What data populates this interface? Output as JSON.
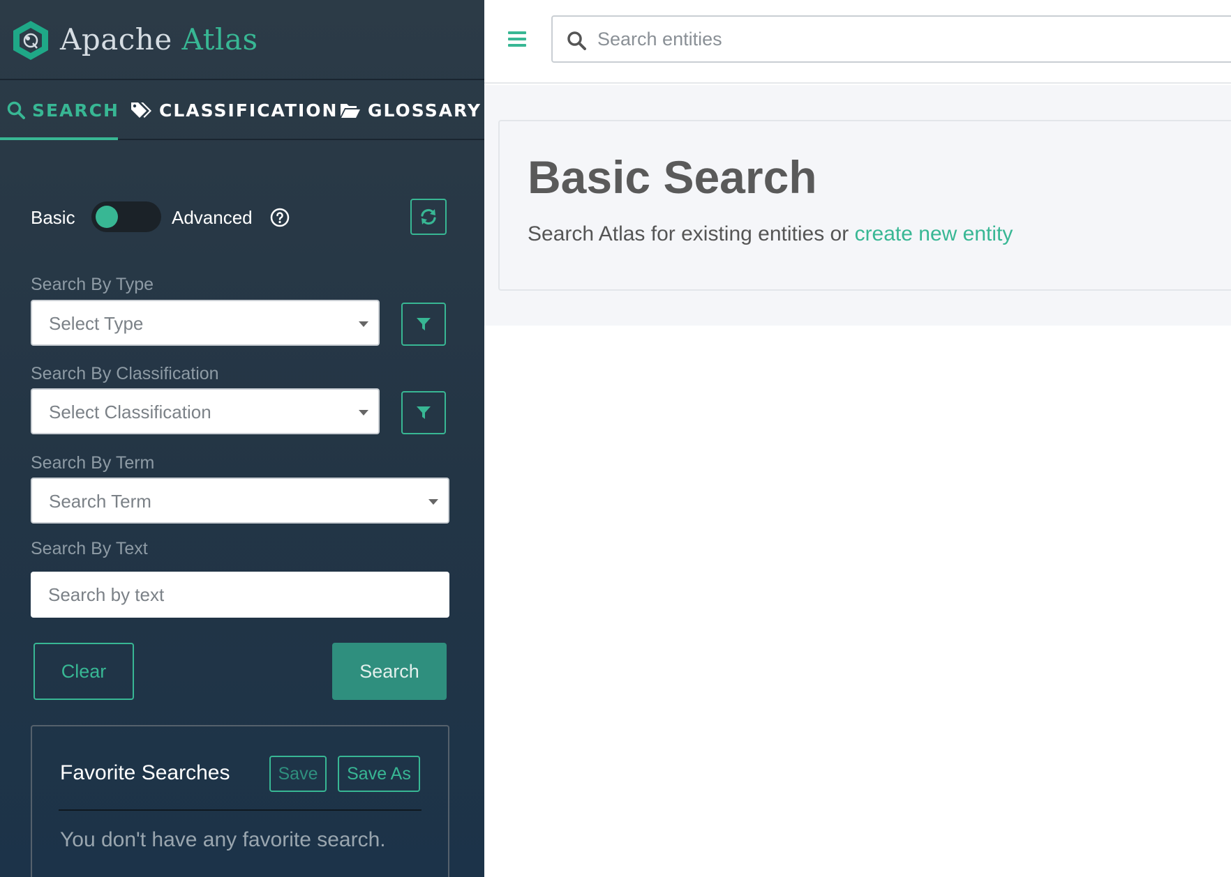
{
  "brand": {
    "name_part1": "Apache",
    "name_part2": "Atlas"
  },
  "tabs": [
    {
      "label": "SEARCH",
      "icon": "search-icon",
      "active": true
    },
    {
      "label": "CLASSIFICATION",
      "icon": "tags-icon",
      "active": false
    },
    {
      "label": "GLOSSARY",
      "icon": "folder-open-icon",
      "active": false
    }
  ],
  "mode_toggle": {
    "basic_label": "Basic",
    "advanced_label": "Advanced",
    "state": "basic"
  },
  "filters": {
    "type": {
      "label": "Search By Type",
      "placeholder": "Select Type"
    },
    "classification": {
      "label": "Search By Classification",
      "placeholder": "Select Classification"
    },
    "term": {
      "label": "Search By Term",
      "placeholder": "Search Term"
    },
    "text": {
      "label": "Search By Text",
      "placeholder": "Search by text"
    }
  },
  "actions": {
    "clear_label": "Clear",
    "search_label": "Search"
  },
  "favorites": {
    "title": "Favorite Searches",
    "save_label": "Save",
    "save_as_label": "Save As",
    "empty_text": "You don't have any favorite search."
  },
  "global_search": {
    "placeholder": "Search entities"
  },
  "main": {
    "title": "Basic Search",
    "subtitle_prefix": "Search Atlas for existing entities or ",
    "create_link": "create new entity"
  },
  "colors": {
    "accent": "#38b794",
    "sidebar_bg": "#233545",
    "main_bg": "#f5f6f9"
  }
}
